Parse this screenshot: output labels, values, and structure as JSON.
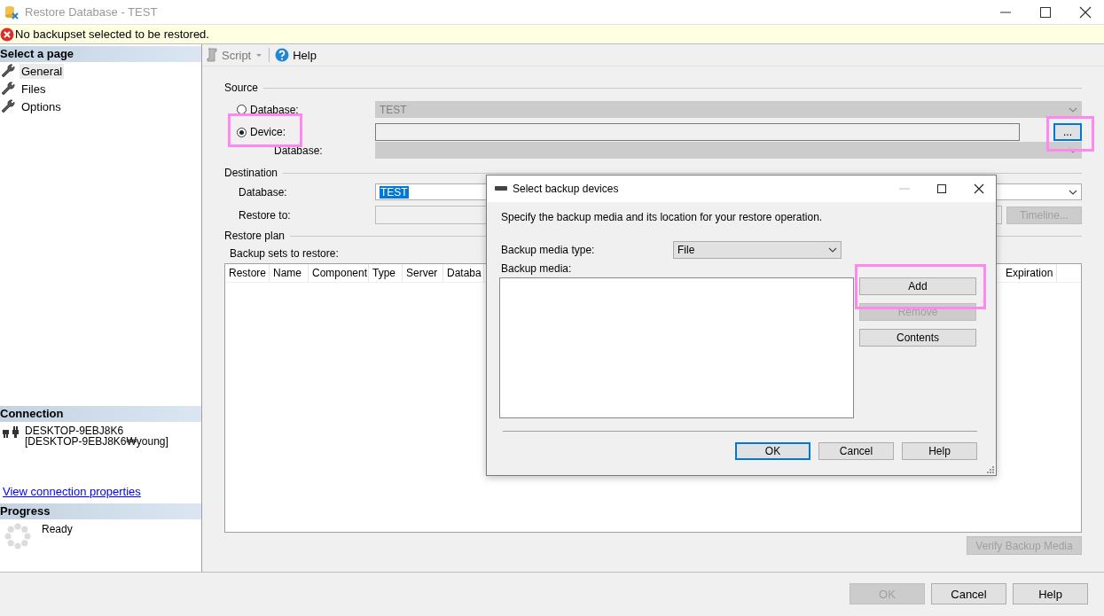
{
  "window": {
    "title": "Restore Database - TEST"
  },
  "error_bar": {
    "message": "No backupset selected to be restored."
  },
  "sidebar": {
    "pages_heading": "Select a page",
    "pages": [
      {
        "label": "General",
        "selected": true
      },
      {
        "label": "Files",
        "selected": false
      },
      {
        "label": "Options",
        "selected": false
      }
    ],
    "connection_heading": "Connection",
    "server": "DESKTOP-9EBJ8K6",
    "login": "[DESKTOP-9EBJ8K6₩young]",
    "properties_link": "View connection properties",
    "progress_heading": "Progress",
    "progress_status": "Ready"
  },
  "toolbar": {
    "script": "Script",
    "help": "Help"
  },
  "source": {
    "heading": "Source",
    "options": [
      {
        "label": "Database:",
        "selected": false
      },
      {
        "label": "Device:",
        "selected": true
      }
    ],
    "database_combo": {
      "value": "TEST",
      "disabled": true
    },
    "browse_button": "...",
    "sub_database_label": "Database:"
  },
  "destination": {
    "heading": "Destination",
    "database_label": "Database:",
    "database_value": "TEST",
    "restore_to_label": "Restore to:",
    "timeline_button": "Timeline..."
  },
  "restore_plan": {
    "heading": "Restore plan",
    "sets_label": "Backup sets to restore:",
    "columns": [
      "Restore",
      "Name",
      "Component",
      "Type",
      "Server",
      "Databa",
      "Expiration"
    ],
    "verify_button": "Verify Backup Media"
  },
  "footer_buttons": [
    {
      "label": "OK",
      "disabled": true
    },
    {
      "label": "Cancel",
      "disabled": false
    },
    {
      "label": "Help",
      "disabled": false
    }
  ],
  "dialog": {
    "title": "Select backup devices",
    "instruction": "Specify the backup media and its location for your restore operation.",
    "media_type_label": "Backup media type:",
    "media_type_value": "File",
    "media_label": "Backup media:",
    "side_buttons": [
      {
        "label": "Add",
        "disabled": false
      },
      {
        "label": "Remove",
        "disabled": true
      },
      {
        "label": "Contents",
        "disabled": false
      }
    ],
    "buttons": [
      {
        "label": "OK",
        "default": true
      },
      {
        "label": "Cancel",
        "default": false
      },
      {
        "label": "Help",
        "default": false
      }
    ]
  }
}
